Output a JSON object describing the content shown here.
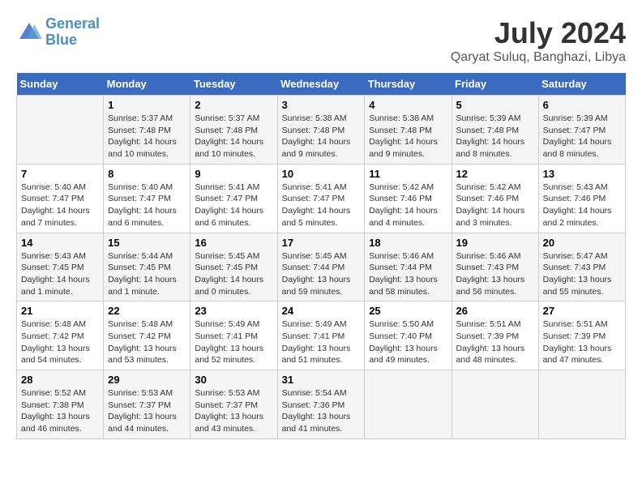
{
  "header": {
    "logo_line1": "General",
    "logo_line2": "Blue",
    "title": "July 2024",
    "subtitle": "Qaryat Suluq, Banghazi, Libya"
  },
  "days_of_week": [
    "Sunday",
    "Monday",
    "Tuesday",
    "Wednesday",
    "Thursday",
    "Friday",
    "Saturday"
  ],
  "weeks": [
    [
      {
        "day": "",
        "info": ""
      },
      {
        "day": "1",
        "info": "Sunrise: 5:37 AM\nSunset: 7:48 PM\nDaylight: 14 hours\nand 10 minutes."
      },
      {
        "day": "2",
        "info": "Sunrise: 5:37 AM\nSunset: 7:48 PM\nDaylight: 14 hours\nand 10 minutes."
      },
      {
        "day": "3",
        "info": "Sunrise: 5:38 AM\nSunset: 7:48 PM\nDaylight: 14 hours\nand 9 minutes."
      },
      {
        "day": "4",
        "info": "Sunrise: 5:38 AM\nSunset: 7:48 PM\nDaylight: 14 hours\nand 9 minutes."
      },
      {
        "day": "5",
        "info": "Sunrise: 5:39 AM\nSunset: 7:48 PM\nDaylight: 14 hours\nand 8 minutes."
      },
      {
        "day": "6",
        "info": "Sunrise: 5:39 AM\nSunset: 7:47 PM\nDaylight: 14 hours\nand 8 minutes."
      }
    ],
    [
      {
        "day": "7",
        "info": "Sunrise: 5:40 AM\nSunset: 7:47 PM\nDaylight: 14 hours\nand 7 minutes."
      },
      {
        "day": "8",
        "info": "Sunrise: 5:40 AM\nSunset: 7:47 PM\nDaylight: 14 hours\nand 6 minutes."
      },
      {
        "day": "9",
        "info": "Sunrise: 5:41 AM\nSunset: 7:47 PM\nDaylight: 14 hours\nand 6 minutes."
      },
      {
        "day": "10",
        "info": "Sunrise: 5:41 AM\nSunset: 7:47 PM\nDaylight: 14 hours\nand 5 minutes."
      },
      {
        "day": "11",
        "info": "Sunrise: 5:42 AM\nSunset: 7:46 PM\nDaylight: 14 hours\nand 4 minutes."
      },
      {
        "day": "12",
        "info": "Sunrise: 5:42 AM\nSunset: 7:46 PM\nDaylight: 14 hours\nand 3 minutes."
      },
      {
        "day": "13",
        "info": "Sunrise: 5:43 AM\nSunset: 7:46 PM\nDaylight: 14 hours\nand 2 minutes."
      }
    ],
    [
      {
        "day": "14",
        "info": "Sunrise: 5:43 AM\nSunset: 7:45 PM\nDaylight: 14 hours\nand 1 minute."
      },
      {
        "day": "15",
        "info": "Sunrise: 5:44 AM\nSunset: 7:45 PM\nDaylight: 14 hours\nand 1 minute."
      },
      {
        "day": "16",
        "info": "Sunrise: 5:45 AM\nSunset: 7:45 PM\nDaylight: 14 hours\nand 0 minutes."
      },
      {
        "day": "17",
        "info": "Sunrise: 5:45 AM\nSunset: 7:44 PM\nDaylight: 13 hours\nand 59 minutes."
      },
      {
        "day": "18",
        "info": "Sunrise: 5:46 AM\nSunset: 7:44 PM\nDaylight: 13 hours\nand 58 minutes."
      },
      {
        "day": "19",
        "info": "Sunrise: 5:46 AM\nSunset: 7:43 PM\nDaylight: 13 hours\nand 56 minutes."
      },
      {
        "day": "20",
        "info": "Sunrise: 5:47 AM\nSunset: 7:43 PM\nDaylight: 13 hours\nand 55 minutes."
      }
    ],
    [
      {
        "day": "21",
        "info": "Sunrise: 5:48 AM\nSunset: 7:42 PM\nDaylight: 13 hours\nand 54 minutes."
      },
      {
        "day": "22",
        "info": "Sunrise: 5:48 AM\nSunset: 7:42 PM\nDaylight: 13 hours\nand 53 minutes."
      },
      {
        "day": "23",
        "info": "Sunrise: 5:49 AM\nSunset: 7:41 PM\nDaylight: 13 hours\nand 52 minutes."
      },
      {
        "day": "24",
        "info": "Sunrise: 5:49 AM\nSunset: 7:41 PM\nDaylight: 13 hours\nand 51 minutes."
      },
      {
        "day": "25",
        "info": "Sunrise: 5:50 AM\nSunset: 7:40 PM\nDaylight: 13 hours\nand 49 minutes."
      },
      {
        "day": "26",
        "info": "Sunrise: 5:51 AM\nSunset: 7:39 PM\nDaylight: 13 hours\nand 48 minutes."
      },
      {
        "day": "27",
        "info": "Sunrise: 5:51 AM\nSunset: 7:39 PM\nDaylight: 13 hours\nand 47 minutes."
      }
    ],
    [
      {
        "day": "28",
        "info": "Sunrise: 5:52 AM\nSunset: 7:38 PM\nDaylight: 13 hours\nand 46 minutes."
      },
      {
        "day": "29",
        "info": "Sunrise: 5:53 AM\nSunset: 7:37 PM\nDaylight: 13 hours\nand 44 minutes."
      },
      {
        "day": "30",
        "info": "Sunrise: 5:53 AM\nSunset: 7:37 PM\nDaylight: 13 hours\nand 43 minutes."
      },
      {
        "day": "31",
        "info": "Sunrise: 5:54 AM\nSunset: 7:36 PM\nDaylight: 13 hours\nand 41 minutes."
      },
      {
        "day": "",
        "info": ""
      },
      {
        "day": "",
        "info": ""
      },
      {
        "day": "",
        "info": ""
      }
    ]
  ]
}
